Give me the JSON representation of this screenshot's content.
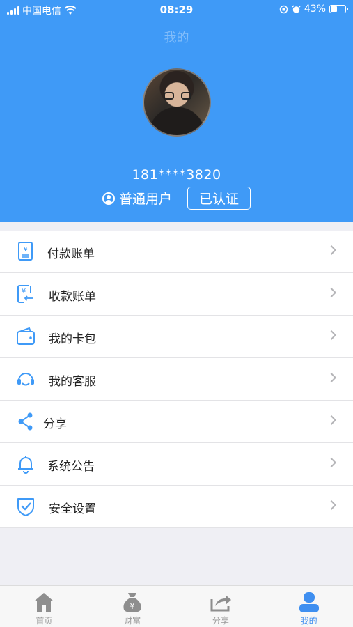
{
  "status_bar": {
    "carrier": "中国电信",
    "time": "08:29",
    "battery": "43%",
    "battery_level": 0.43
  },
  "header": {
    "title": "我的",
    "phone": "181****3820",
    "user_type": "普通用户",
    "verified": "已认证"
  },
  "menu": [
    {
      "label": "付款账单",
      "icon": "payment-bill-icon"
    },
    {
      "label": "收款账单",
      "icon": "receipt-bill-icon"
    },
    {
      "label": "我的卡包",
      "icon": "wallet-icon"
    },
    {
      "label": "我的客服",
      "icon": "headset-icon"
    },
    {
      "label": "分享",
      "icon": "share-icon"
    },
    {
      "label": "系统公告",
      "icon": "bell-icon"
    },
    {
      "label": "安全设置",
      "icon": "shield-icon"
    }
  ],
  "tabs": [
    {
      "label": "首页",
      "icon": "home-icon"
    },
    {
      "label": "财富",
      "icon": "money-bag-icon"
    },
    {
      "label": "分享",
      "icon": "share-arrow-icon"
    },
    {
      "label": "我的",
      "icon": "profile-icon",
      "active": true
    }
  ],
  "colors": {
    "primary": "#3f9af7",
    "active_tab": "#3f8ff0",
    "background": "#efeff4"
  }
}
